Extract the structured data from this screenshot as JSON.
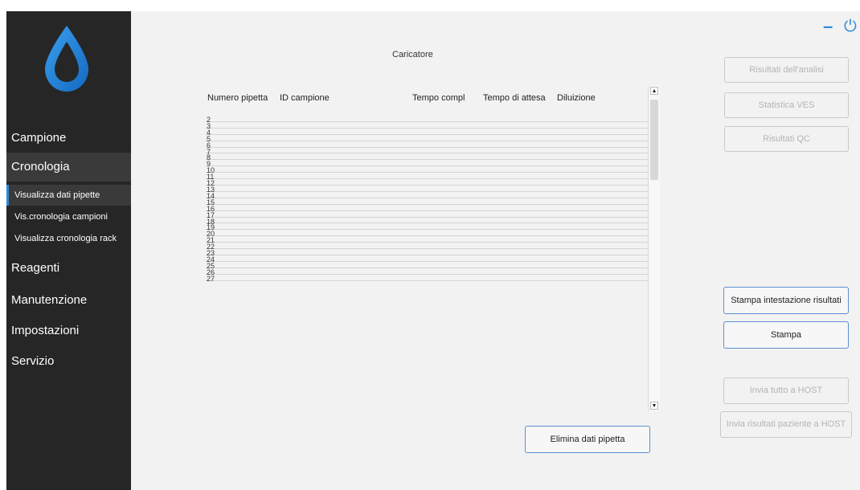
{
  "sidebar": {
    "items": [
      {
        "label": "Campione"
      },
      {
        "label": "Cronologia"
      },
      {
        "label": "Visualizza dati pipette"
      },
      {
        "label": "Vis.cronologia campioni"
      },
      {
        "label": "Visualizza cronologia rack"
      },
      {
        "label": "Reagenti"
      },
      {
        "label": "Manutenzione"
      },
      {
        "label": "Impostazioni"
      },
      {
        "label": "Servizio"
      }
    ]
  },
  "header": {
    "minimize_label": "–",
    "power_label": "⏻"
  },
  "main": {
    "title": "Caricatore",
    "table": {
      "columns": [
        "Numero pipetta",
        "ID campione",
        "Tempo compl",
        "Tempo di attesa",
        "Diluizione"
      ],
      "rows": [
        "2",
        "3",
        "4",
        "5",
        "6",
        "7",
        "8",
        "9",
        "10",
        "11",
        "12",
        "13",
        "14",
        "15",
        "16",
        "17",
        "18",
        "19",
        "20",
        "21",
        "22",
        "23",
        "24",
        "25",
        "26",
        "27"
      ]
    },
    "delete_button": "Elimina dati pipetta"
  },
  "right_panel": {
    "buttons": {
      "analysis_results": "Risultati dell'analisi",
      "ves_statistics": "Statistica VES",
      "qc_results": "Risultati QC",
      "print_header": "Stampa intestazione risultati",
      "print": "Stampa",
      "send_all_host": "Invia tutto a HOST",
      "send_patient_host": "Invia risultati paziente a HOST"
    }
  },
  "colors": {
    "accent": "#2d8ad8",
    "sidebar_bg": "#262626",
    "panel_bg": "#f2f2f2"
  }
}
